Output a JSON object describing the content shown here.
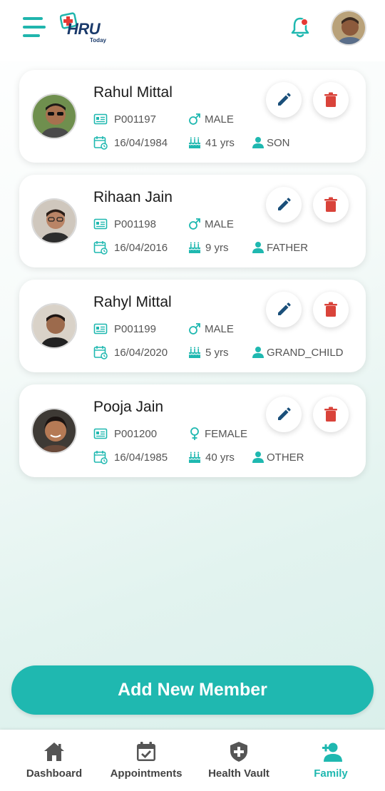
{
  "header": {
    "logo_text": "HRU",
    "logo_sub": "Today"
  },
  "members": [
    {
      "name": "Rahul Mittal",
      "patient_id": "P001197",
      "gender": "MALE",
      "dob": "16/04/1984",
      "age": "41 yrs",
      "relation": "SON",
      "gender_icon": "male-icon"
    },
    {
      "name": "Rihaan Jain",
      "patient_id": "P001198",
      "gender": "MALE",
      "dob": "16/04/2016",
      "age": "9 yrs",
      "relation": "FATHER",
      "gender_icon": "male-icon"
    },
    {
      "name": "Rahyl Mittal",
      "patient_id": "P001199",
      "gender": "MALE",
      "dob": "16/04/2020",
      "age": "5 yrs",
      "relation": "GRAND_CHILD",
      "gender_icon": "male-icon"
    },
    {
      "name": "Pooja Jain",
      "patient_id": "P001200",
      "gender": "FEMALE",
      "dob": "16/04/1985",
      "age": "40 yrs",
      "relation": "OTHER",
      "gender_icon": "female-icon"
    }
  ],
  "add_button_label": "Add New Member",
  "nav": {
    "items": [
      {
        "label": "Dashboard",
        "icon": "home-icon"
      },
      {
        "label": "Appointments",
        "icon": "calendar-check-icon"
      },
      {
        "label": "Health Vault",
        "icon": "shield-plus-icon"
      },
      {
        "label": "Family",
        "icon": "add-person-icon"
      }
    ],
    "active": "Family"
  },
  "colors": {
    "accent": "#1fb8b0",
    "edit_icon": "#1a4f7a",
    "delete_icon": "#d9433a",
    "notification_dot": "#e53935"
  }
}
